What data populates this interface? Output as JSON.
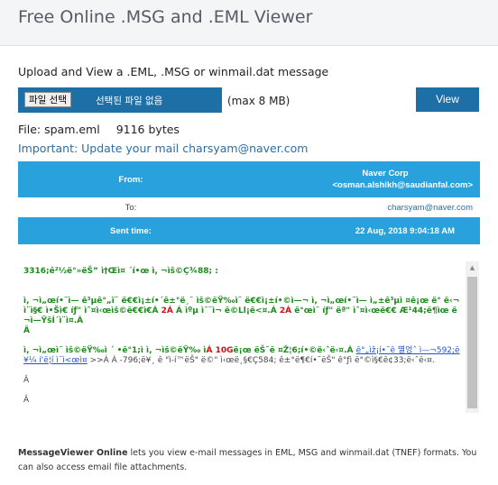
{
  "header": {
    "title": "Free Online .MSG and .EML Viewer"
  },
  "upload": {
    "label": "Upload and View a .EML, .MSG or winmail.dat message",
    "choose_button": "파일 선택",
    "no_file": "선택된 파일 없음",
    "max_size": "(max 8 MB)",
    "view_button": "View"
  },
  "file": {
    "name_label": "File: spam.eml",
    "size_label": "9116 bytes"
  },
  "notice": "Important: Update your mail charsyam@naver.com",
  "message_header": {
    "from_label": "From:",
    "from_name": "Naver Corp",
    "from_email": "<osman.alshikh@saudianfal.com>",
    "to_label": "To:",
    "to_value": "charsyam@naver.com",
    "sent_label": "Sent time:",
    "sent_value": "22 Aug, 2018 9:04:18 AM"
  },
  "body": {
    "p1": "3316;ê²½ë°»ëŠ”  ì†Œì¤  ´í•œ ì, ¬ìš©Ç¾88; :",
    "p2a": "ì, ¬ì„œí•˜ì—  ê³µê°„ï¨ ë€€ì¡±í•´ê±°ë¸¨ ìš©ëŸ‰ì¨ ë€€ì¡±í•©ì—¬ ì, ¬ì„œí•˜ì—  ì„±ê³µì ¤ê¡œ ë° ë‹¬ì¨ì§€ ì•Šì€ íƒ\" ìˆ¤ì‹œìš©ë€€ì€Á ",
    "p2red": "2Á",
    "p2b": " Á ìºµ ì˜¨ì¬ ê©Ll¡ë<¤.Á ",
    "p2red2": "2Á",
    "p2c": " ê°œì˜ íƒ\" ëª\" ìˆ¤ì‹œë€€ Æ¹44;ë¶ìœ ë ¬ì—ŸšÍ´ì¨ì¤.Á",
    "p2d": "Â",
    "p3a": "ì, ¬ì„œì˜ ìš©ëŸ‰ì ´ •ê°1;ì ì, ¬ìš©ëŸ‰ ì",
    "p3red": "Á 10G",
    "p3b": "ë¡œ ëŠ˜ë ¤Ž¦6;í•©ë‹ˆë‹¤.",
    "p3c": "Á ",
    "p3link": "ê°„ìž¡í•˜ê 멸엉ˆ ì—¬592;ë¥¼ í'ë¦í ì¨ì<œì¤",
    "p3d": " >>Á Á -796;ë¥¸ ê \"ì-í™ëŠ\"  ë©\" ì‹œë¸§€Ç584; ê±°ë¶€í•˜ëŠ\"  ê°ƒì  ë°©ì§€ê¢33;ë‹ˆë‹¤.",
    "p4": "Â",
    "p5": "Â"
  },
  "footer": {
    "brand": "MessageViewer Online",
    "text": " lets you view e-mail messages in EML, MSG and winmail.dat (TNEF) formats. You can also access email file attachments."
  }
}
